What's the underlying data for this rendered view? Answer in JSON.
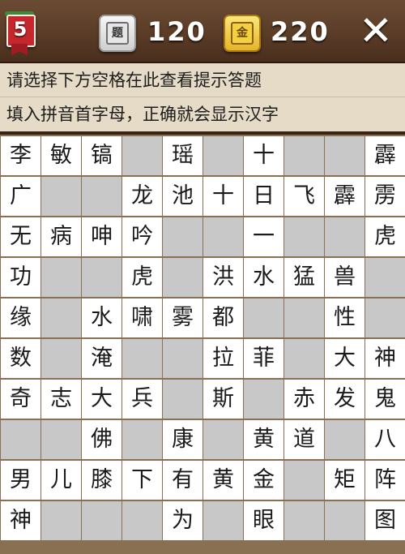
{
  "header": {
    "level": "5",
    "silver_icon_label": "题",
    "silver_count": "120",
    "gold_icon_label": "金",
    "gold_count": "220",
    "close_label": "✕"
  },
  "hints": {
    "line1": "请选择下方空格在此查看提示答题",
    "line2": "填入拼音首字母，正确就会显示汉字"
  },
  "colors": {
    "filled_cell": "#ffffff",
    "empty_cell": "#c8c8c8",
    "grid_line": "#8a7052",
    "top_bar": "#5a3c27",
    "hint_bg": "#e6dbc6"
  },
  "grid": [
    [
      "李",
      "敏",
      "镐",
      "",
      "瑶",
      "",
      "十",
      "",
      "",
      "霹"
    ],
    [
      "广",
      "",
      "",
      "龙",
      "池",
      "十",
      "日",
      "飞",
      "霹",
      "雳"
    ],
    [
      "无",
      "病",
      "呻",
      "吟",
      "",
      "",
      "一",
      "",
      "",
      "虎"
    ],
    [
      "功",
      "",
      "",
      "虎",
      "",
      "洪",
      "水",
      "猛",
      "兽",
      ""
    ],
    [
      "缘",
      "",
      "水",
      "啸",
      "雾",
      "都",
      "",
      "",
      "性",
      ""
    ],
    [
      "数",
      "",
      "淹",
      "",
      "",
      "拉",
      "菲",
      "",
      "大",
      "神"
    ],
    [
      "奇",
      "志",
      "大",
      "兵",
      "",
      "斯",
      "",
      "赤",
      "发",
      "鬼"
    ],
    [
      "",
      "",
      "佛",
      "",
      "康",
      "",
      "黄",
      "道",
      "",
      "八"
    ],
    [
      "男",
      "儿",
      "膝",
      "下",
      "有",
      "黄",
      "金",
      "",
      "矩",
      "阵"
    ],
    [
      "神",
      "",
      "",
      "",
      "为",
      "",
      "眼",
      "",
      "",
      "图"
    ]
  ]
}
